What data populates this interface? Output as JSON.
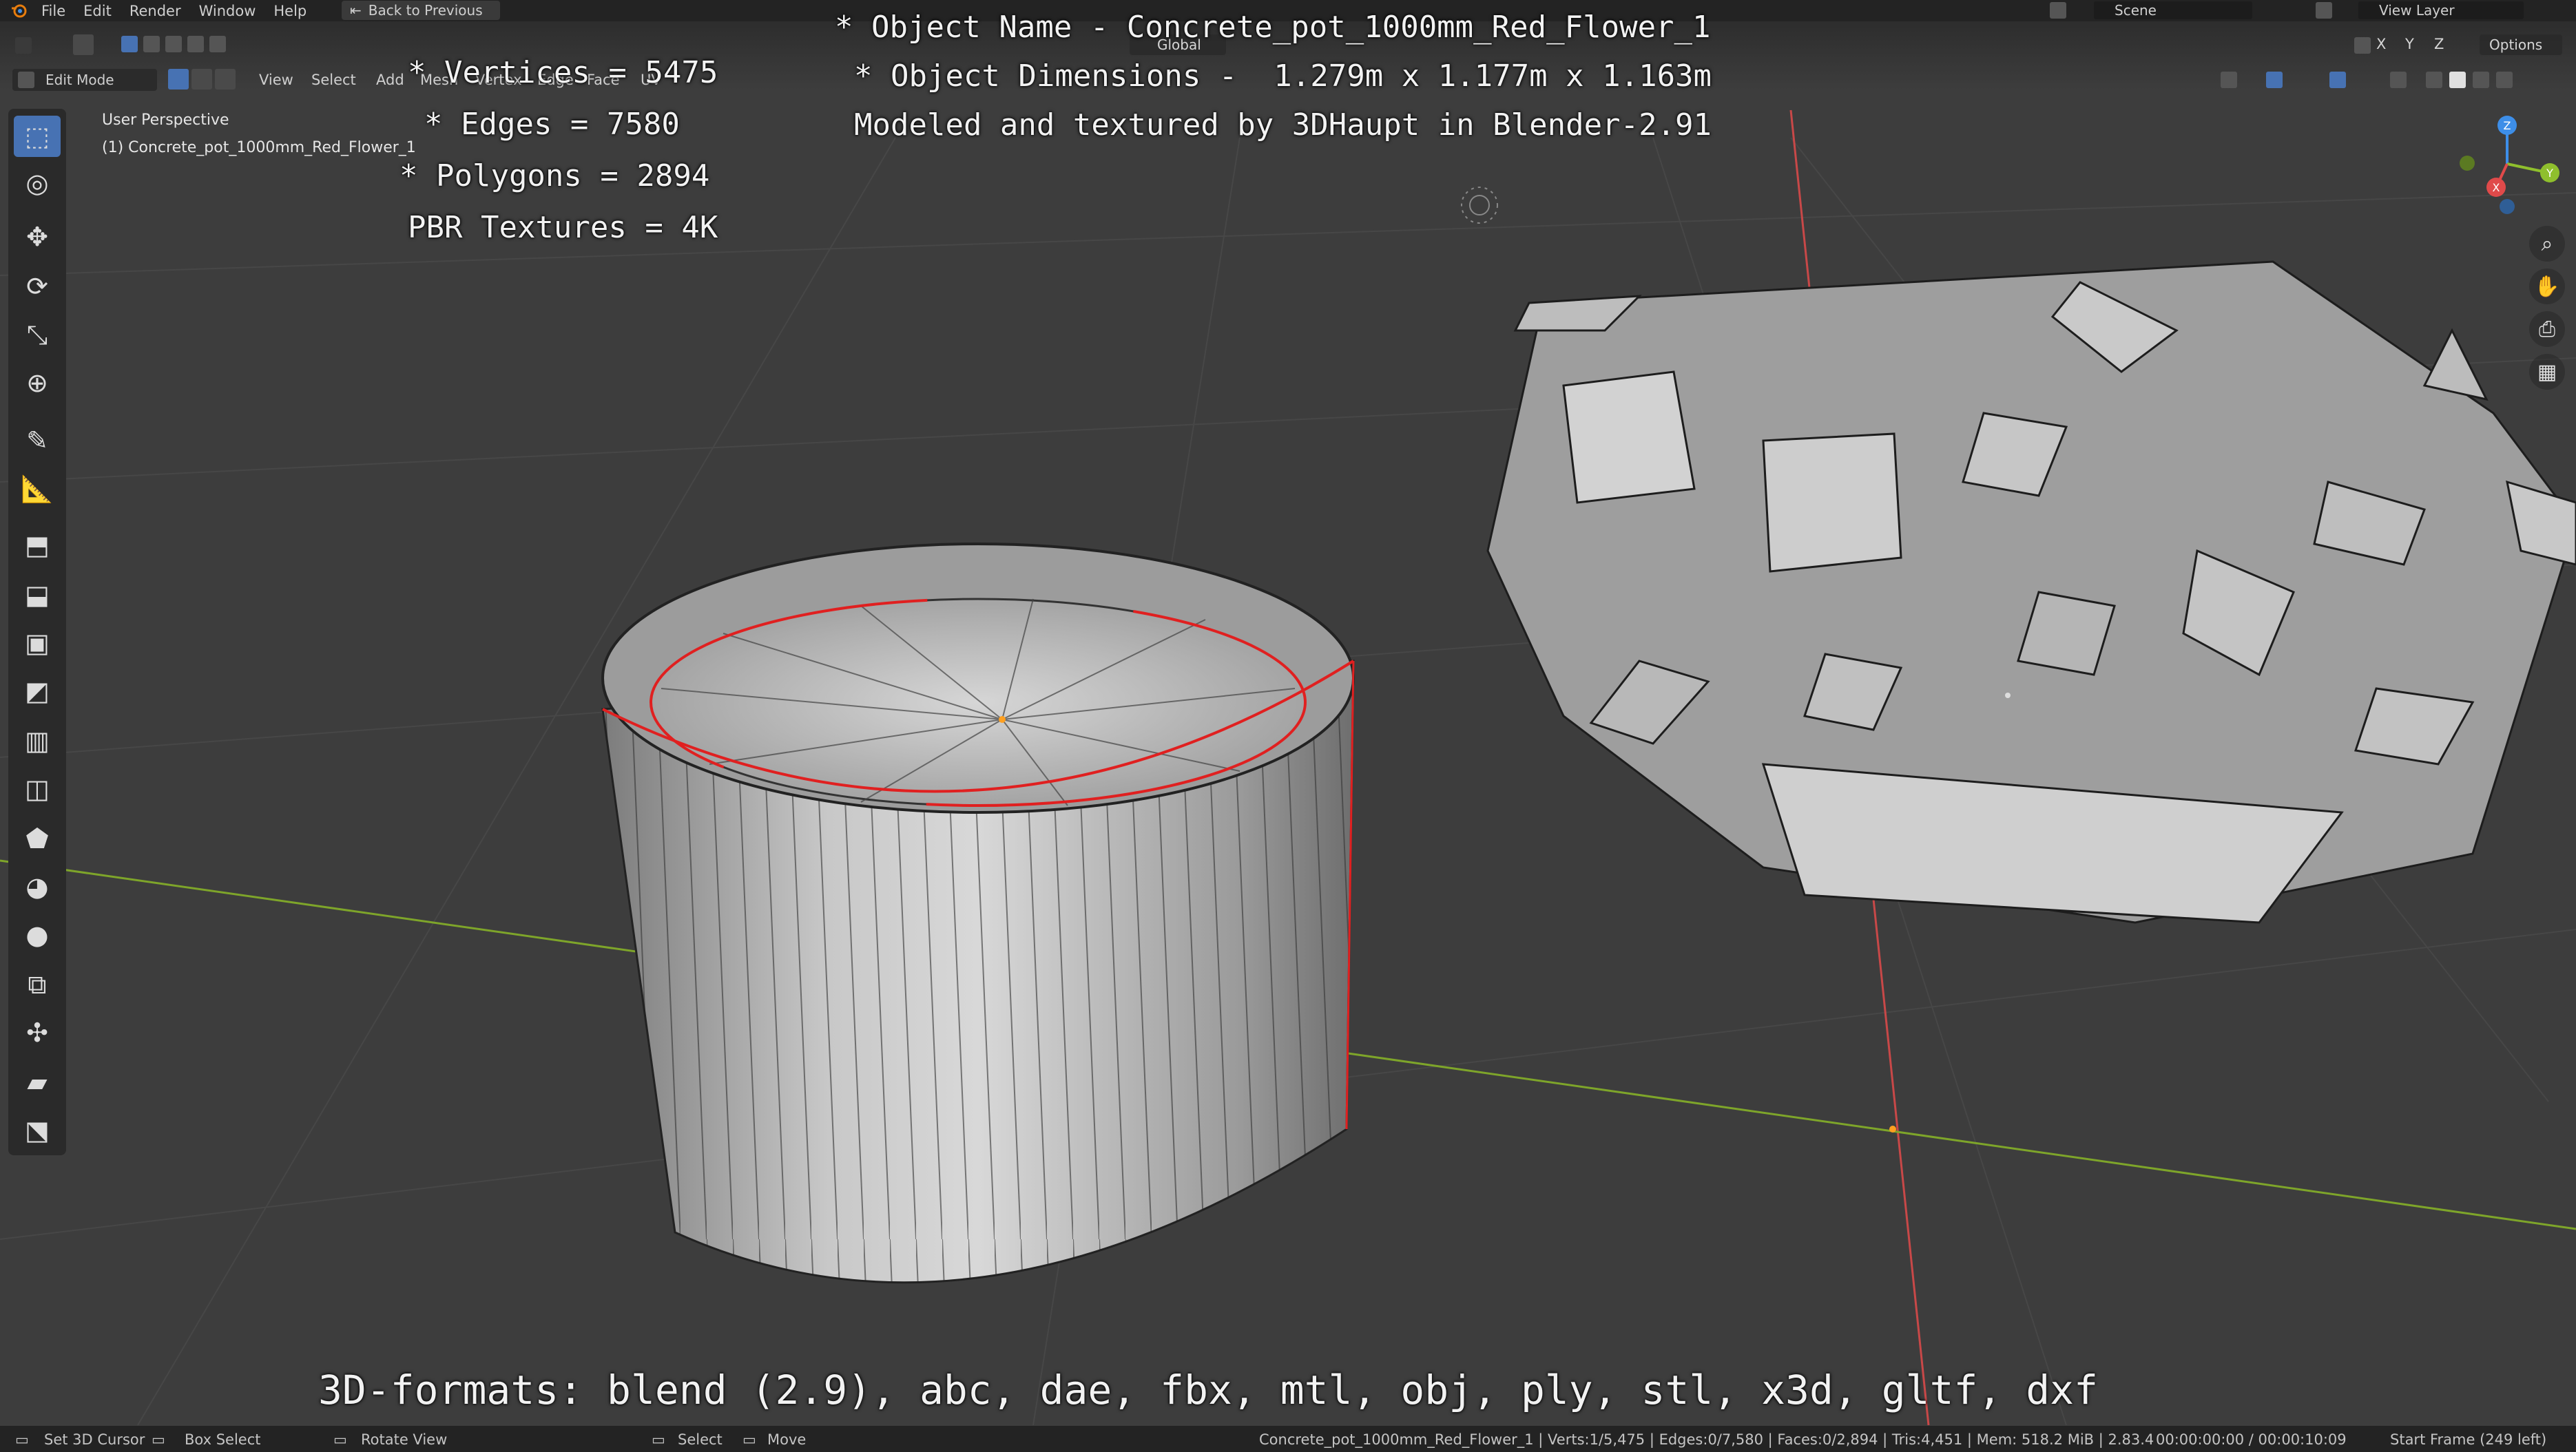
{
  "menu": {
    "items": [
      "File",
      "Edit",
      "Render",
      "Window",
      "Help"
    ],
    "back_button": "Back to Previous"
  },
  "header_right": {
    "scene": "Scene",
    "view_layer": "View Layer",
    "options": "Options",
    "axes": [
      "X",
      "Y",
      "Z"
    ]
  },
  "viewport_header": {
    "mode": "Edit Mode",
    "menus": [
      "View",
      "Select",
      "Add",
      "Mesh",
      "Vertex",
      "Edge",
      "Face",
      "UV"
    ],
    "transform_orientation": "Global"
  },
  "viewport": {
    "perspective_label": "User Perspective",
    "object_label": "(1) Concrete_pot_1000mm_Red_Flower_1"
  },
  "overlay": {
    "vertices": "* Vertices = 5475",
    "edges": "* Edges = 7580",
    "polygons": "* Polygons = 2894",
    "textures": "PBR Textures = 4K",
    "object_name": "* Object Name - Concrete_pot_1000mm_Red_Flower_1",
    "dimensions": "* Object Dimensions -  1.279m x 1.177m x 1.163m",
    "credit": "Modeled and textured by 3DHaupt in Blender-2.91",
    "formats": "3D-formats: blend (2.9), abc, dae, fbx, mtl, obj, ply, stl, x3d, gltf, dxf"
  },
  "toolbar": {
    "tools": [
      "select-box-icon",
      "cursor-icon",
      "move-icon",
      "rotate-icon",
      "scale-icon",
      "transform-icon",
      "annotate-icon",
      "measure-icon",
      "add-cube-icon",
      "extrude-icon",
      "inset-icon",
      "bevel-icon",
      "loop-cut-icon",
      "knife-icon",
      "poly-build-icon",
      "spin-icon",
      "smooth-icon",
      "edge-slide-icon",
      "shrink-fatten-icon",
      "shear-icon",
      "rip-icon"
    ]
  },
  "statusbar": {
    "set_cursor": "Set 3D Cursor",
    "box_select": "Box Select",
    "rotate_view": "Rotate View",
    "select": "Select",
    "move": "Move",
    "stats": "Concrete_pot_1000mm_Red_Flower_1 | Verts:1/5,475 | Edges:0/7,580 | Faces:0/2,894 | Tris:4,451 | Mem: 518.2 MiB | 2.83.4",
    "time": "00:00:00:00 / 00:00:10:09",
    "frame": "Start Frame (249 left)"
  },
  "colors": {
    "selection_blue": "#4772b3",
    "x_axis": "#e04a4a",
    "y_axis": "#8fbf2d",
    "z_axis": "#3d8ee8",
    "seam_red": "#e02020"
  }
}
